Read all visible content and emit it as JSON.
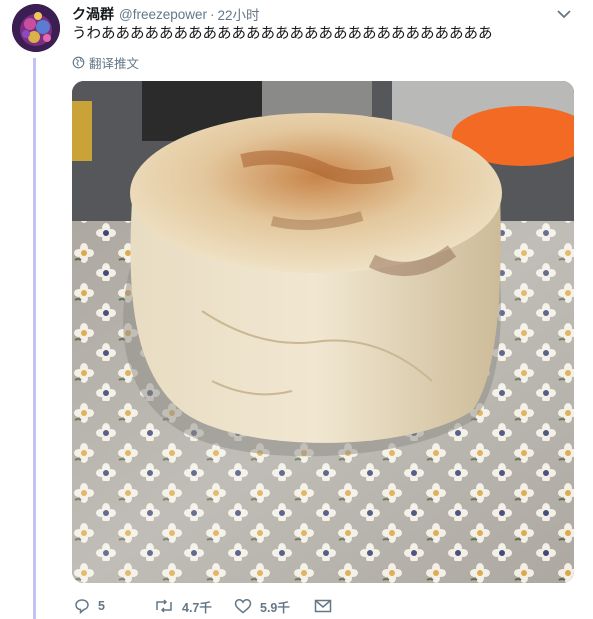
{
  "tweet": {
    "display_name": "ク渦群",
    "handle": "@freezepower",
    "separator": "·",
    "time": "22小时",
    "text": "うわあああああああああああああああああああああああああああ",
    "translate_label": "翻译推文"
  },
  "actions": {
    "reply_count": "5",
    "retweet_count": "4.7千",
    "like_count": "5.9千"
  },
  "colors": {
    "thread_line": "#c4c2f5",
    "secondary_text": "#657786"
  },
  "icons": {
    "menu": "chevron-down-icon",
    "translate": "globe-icon",
    "reply": "reply-icon",
    "retweet": "retweet-icon",
    "like": "heart-icon",
    "message": "envelope-icon"
  }
}
